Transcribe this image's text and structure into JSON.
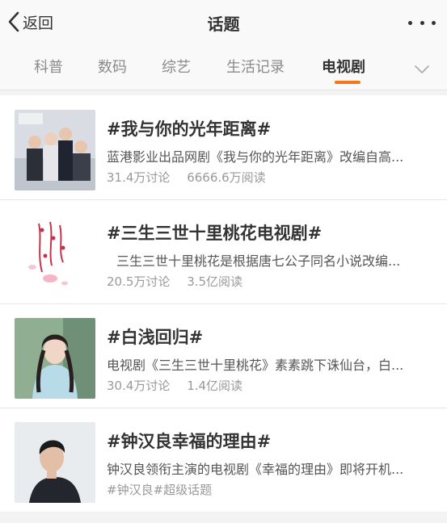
{
  "navbar": {
    "back_label": "返回",
    "title": "话题",
    "back_icon": "chevron-left-icon",
    "more_icon": "more-dots-icon"
  },
  "tabs": {
    "items": [
      {
        "label": "科普"
      },
      {
        "label": "数码"
      },
      {
        "label": "综艺"
      },
      {
        "label": "生活记录"
      },
      {
        "label": "电视剧"
      }
    ],
    "active_index": 4,
    "active_color": "#f5761a",
    "expand_icon": "chevron-down-icon"
  },
  "topics": [
    {
      "title": "#我与你的光年距离#",
      "desc": "蓝港影业出品网剧《我与你的光年距离》改编自高...",
      "discuss": "31.4万讨论",
      "reads": "6666.6万阅读"
    },
    {
      "title": "#三生三世十里桃花电视剧#",
      "desc": "三生三世十里桃花是根据唐七公子同名小说改编...",
      "discuss": "20.5万讨论",
      "reads": "3.5亿阅读"
    },
    {
      "title": "#白浅回归#",
      "desc": "电视剧《三生三世十里桃花》素素跳下诛仙台，白...",
      "discuss": "30.4万讨论",
      "reads": "1.4亿阅读"
    },
    {
      "title": "#钟汉良幸福的理由#",
      "desc": "钟汉良领衔主演的电视剧《幸福的理由》即将开机...",
      "tags": "#钟汉良#超级话题"
    }
  ]
}
